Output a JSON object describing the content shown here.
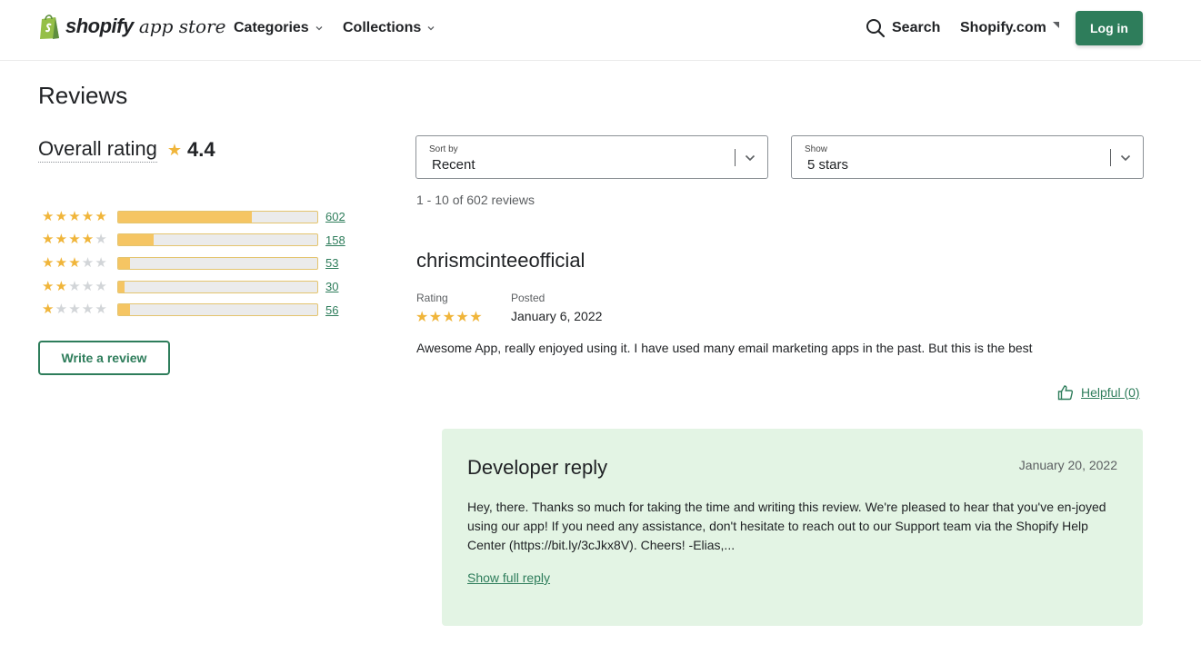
{
  "header": {
    "logo_bold": "shopify",
    "logo_light": "app store",
    "nav": [
      {
        "label": "Categories"
      },
      {
        "label": "Collections"
      }
    ],
    "search_label": "Search",
    "shopify_link": "Shopify.com",
    "login_label": "Log in"
  },
  "reviews": {
    "title": "Reviews",
    "overall_label": "Overall rating",
    "overall_value": "4.4",
    "distribution": [
      {
        "stars": 5,
        "count": "602",
        "fraction": 0.67
      },
      {
        "stars": 4,
        "count": "158",
        "fraction": 0.18
      },
      {
        "stars": 3,
        "count": "53",
        "fraction": 0.06
      },
      {
        "stars": 2,
        "count": "30",
        "fraction": 0.03
      },
      {
        "stars": 1,
        "count": "56",
        "fraction": 0.06
      }
    ],
    "write_review_label": "Write a review"
  },
  "filters": {
    "sort_label": "Sort by",
    "sort_value": "Recent",
    "show_label": "Show",
    "show_value": "5 stars"
  },
  "results_text": "1 - 10 of 602 reviews",
  "review": {
    "author": "chrismcinteeofficial",
    "rating_label": "Rating",
    "rating": 5,
    "posted_label": "Posted",
    "posted_date": "January 6, 2022",
    "body": "Awesome App, really enjoyed using it. I have used many email marketing apps in the past. But this is the best",
    "helpful_label": "Helpful (0)"
  },
  "developer_reply": {
    "title": "Developer reply",
    "date": "January 20, 2022",
    "body": "Hey, there. Thanks so much for taking the time and writing this review. We're pleased to hear that you've en-joyed using our app! If you need any assistance, don't hesitate to reach out to our Support team via the Shopify Help Center (https://bit.ly/3cJkx8V). Cheers! -Elias,...",
    "show_full_label": "Show full reply"
  },
  "colors": {
    "brand_green": "#2e7d5b",
    "star_gold": "#f0b53a",
    "bar_fill": "#f5c563",
    "reply_bg": "#e3f4e4"
  },
  "icons": [
    "shopify-bag-icon",
    "chevron-down-icon",
    "search-icon",
    "external-link-icon",
    "star-icon",
    "thumbs-up-icon"
  ]
}
